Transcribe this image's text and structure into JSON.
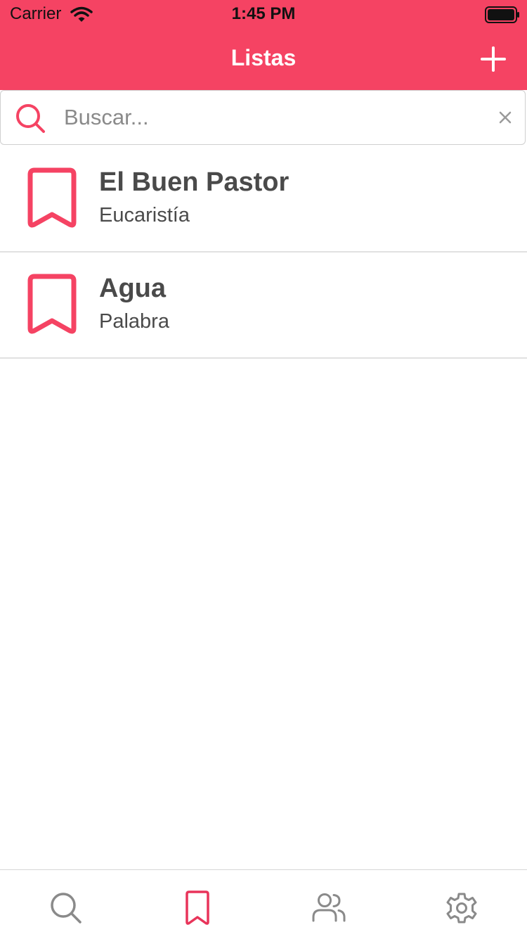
{
  "status_bar": {
    "carrier": "Carrier",
    "time": "1:45 PM"
  },
  "nav": {
    "title": "Listas",
    "add_icon": "plus-icon"
  },
  "search": {
    "placeholder": "Buscar...",
    "value": "",
    "icon": "search-icon",
    "clear_icon": "close-icon"
  },
  "lists": [
    {
      "title": "El Buen Pastor",
      "subtitle": "Eucaristía",
      "icon": "bookmark-icon"
    },
    {
      "title": "Agua",
      "subtitle": "Palabra",
      "icon": "bookmark-icon"
    }
  ],
  "tabbar": {
    "tabs": [
      {
        "icon": "search-icon",
        "active": false
      },
      {
        "icon": "bookmark-icon",
        "active": true
      },
      {
        "icon": "users-icon",
        "active": false
      },
      {
        "icon": "gear-icon",
        "active": false
      }
    ]
  },
  "colors": {
    "accent": "#f54363",
    "tab_active": "#e8345a",
    "tab_inactive": "#8a8a8a",
    "text": "#4a4a4a"
  }
}
